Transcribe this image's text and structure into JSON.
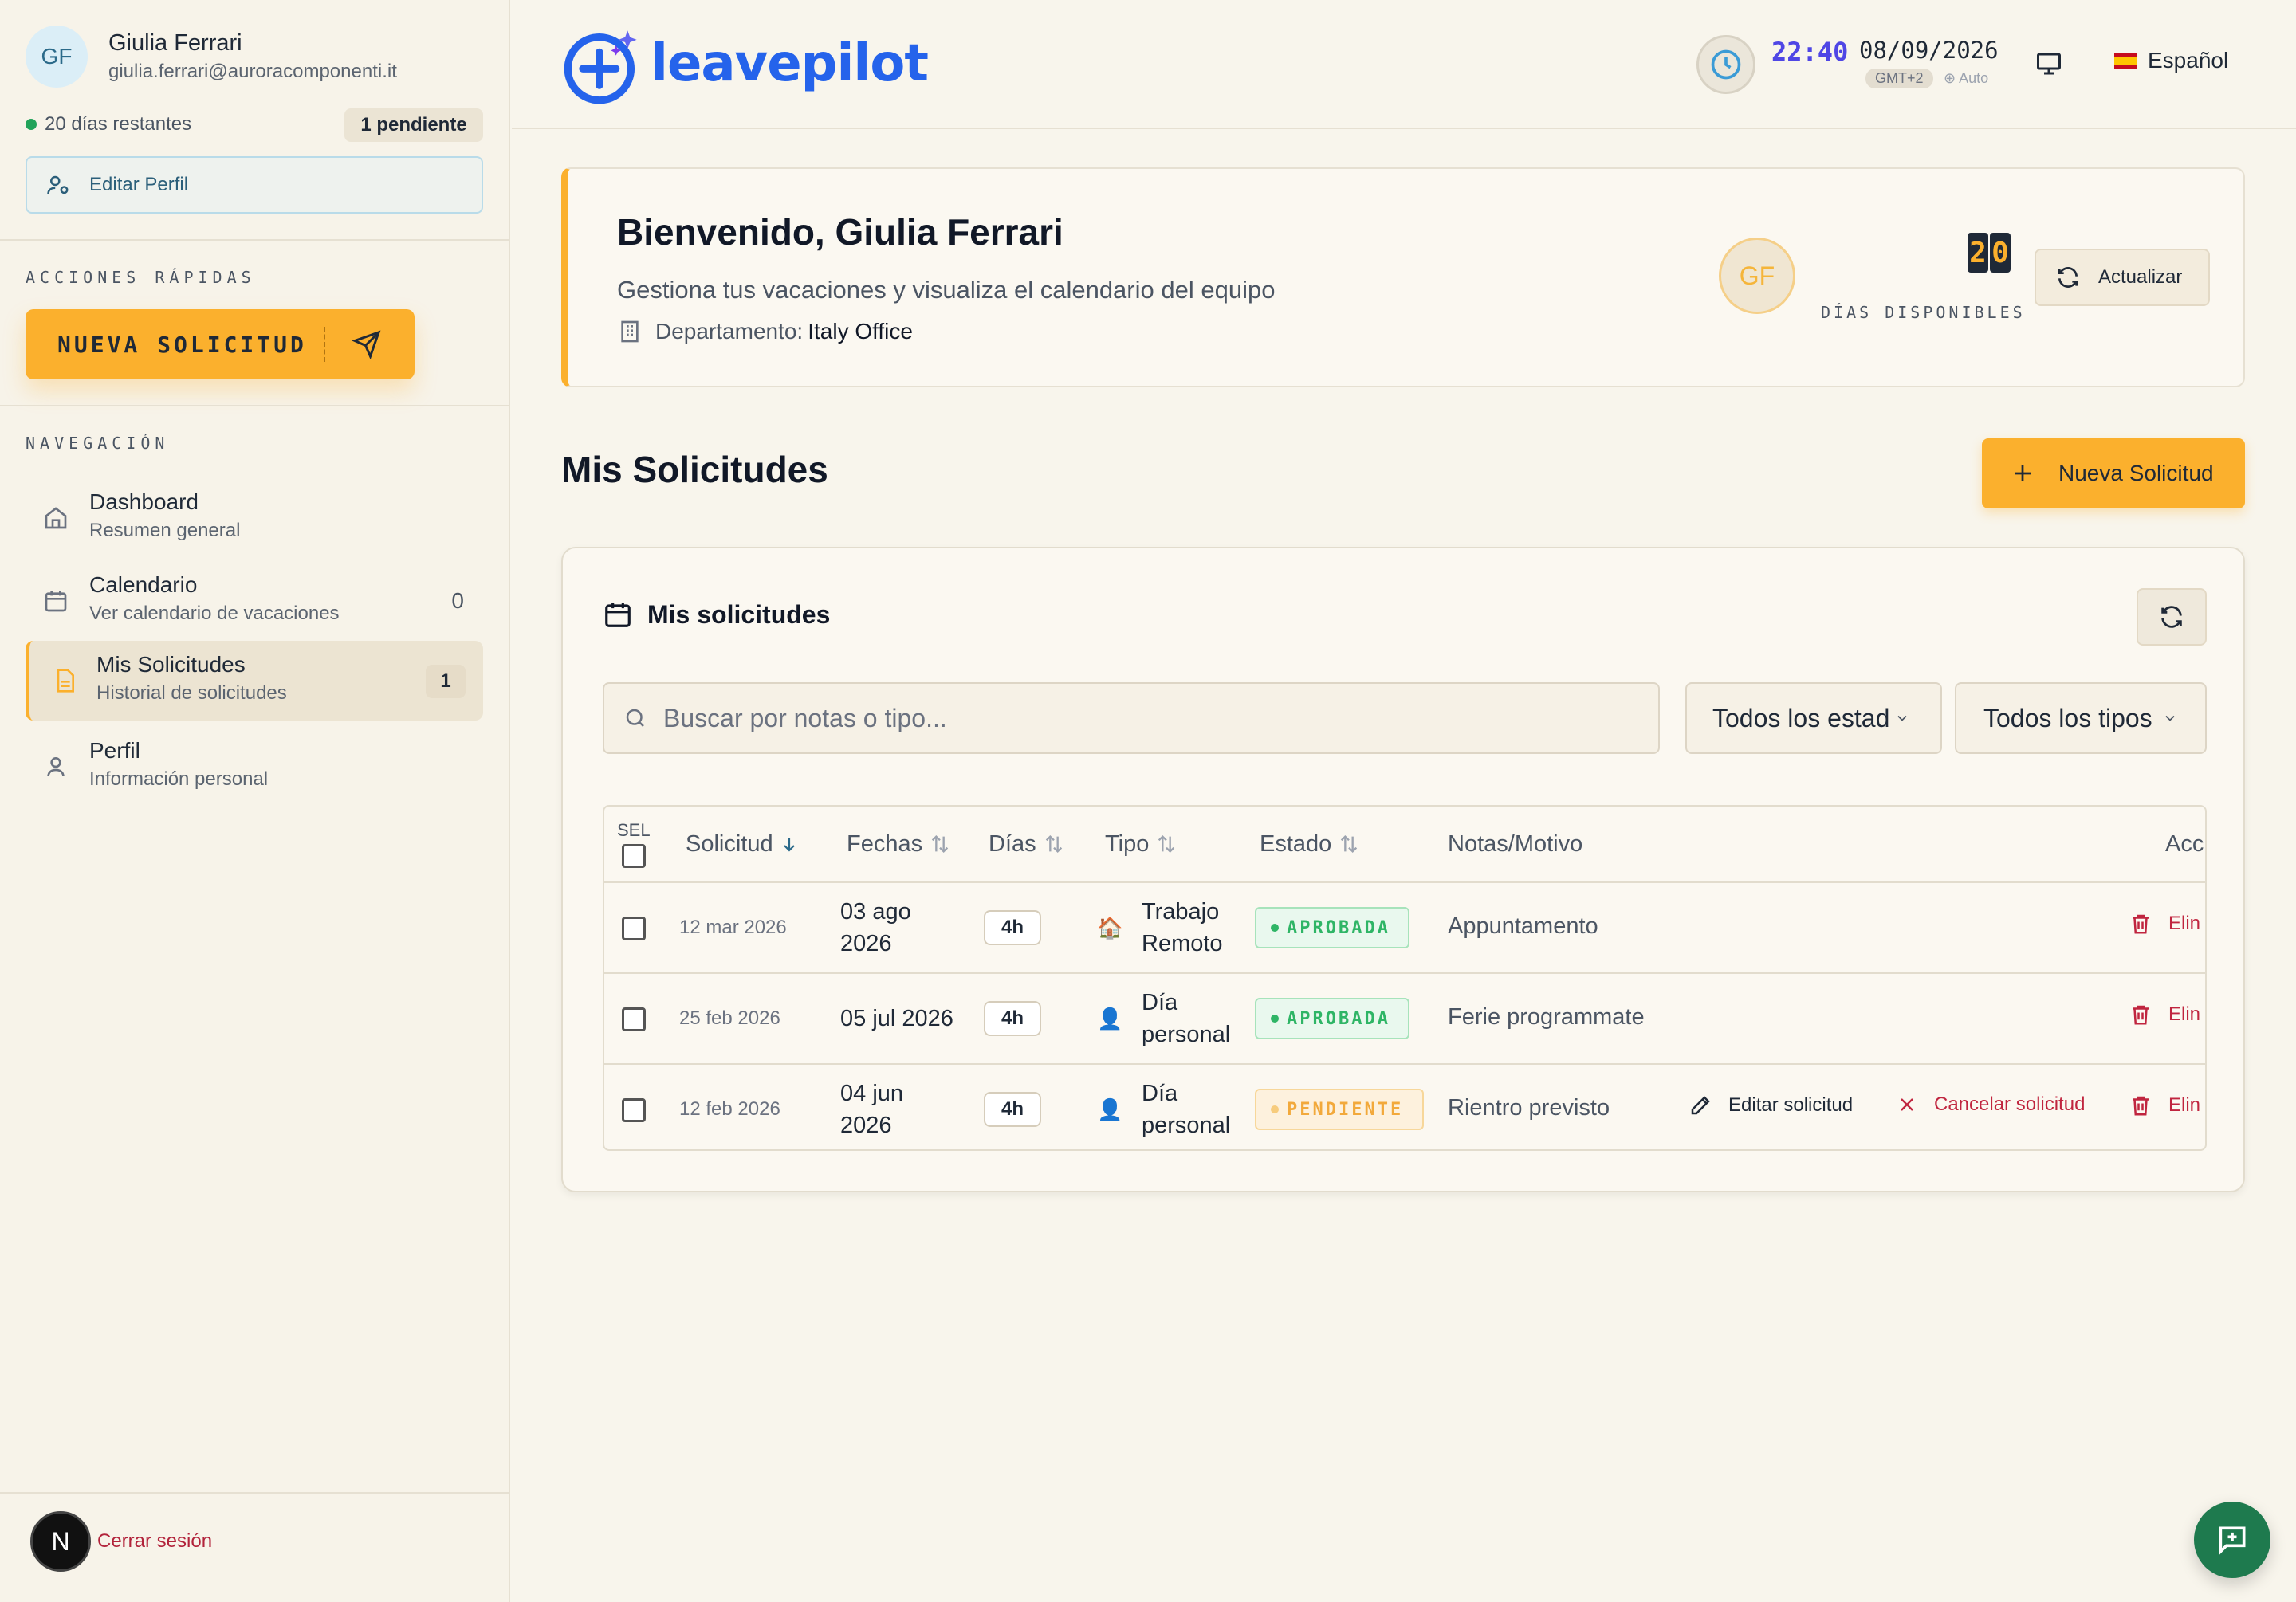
{
  "user": {
    "initials": "GF",
    "name": "Giulia Ferrari",
    "email": "giulia.ferrari@auroracomponenti.it",
    "days_remaining": "20 días restantes",
    "pending": "1 pendiente",
    "edit_profile": "Editar Perfil"
  },
  "sidebar": {
    "quick_actions": "ACCIONES RÁPIDAS",
    "new_request": "NUEVA SOLICITUD",
    "navigation": "NAVEGACIÓN",
    "items": [
      {
        "title": "Dashboard",
        "subtitle": "Resumen general",
        "count": ""
      },
      {
        "title": "Calendario",
        "subtitle": "Ver calendario de vacaciones",
        "count": "0"
      },
      {
        "title": "Mis Solicitudes",
        "subtitle": "Historial de solicitudes",
        "count": "1"
      },
      {
        "title": "Perfil",
        "subtitle": "Información personal",
        "count": ""
      }
    ],
    "logout": "Cerrar sesión",
    "logo_letter": "N"
  },
  "header": {
    "brand": "leavepilot",
    "time": "22:40",
    "date": "08/09/2026",
    "timezone": "GMT+2",
    "tz_mode": "Auto",
    "language": "Español"
  },
  "welcome": {
    "title": "Bienvenido, Giulia Ferrari",
    "subtitle": "Gestiona tus vacaciones y visualiza el calendario del equipo",
    "dept_label": "Departamento:",
    "dept_value": "Italy Office",
    "avatar": "GF",
    "digit1": "2",
    "digit2": "0",
    "days_label": "DÍAS DISPONIBLES",
    "refresh": "Actualizar"
  },
  "section": {
    "title": "Mis Solicitudes",
    "new_button": "Nueva Solicitud"
  },
  "card": {
    "title": "Mis solicitudes",
    "search_placeholder": "Buscar por notas o tipo...",
    "filter_status": "Todos los estad",
    "filter_type": "Todos los tipos",
    "columns": {
      "sel": "SEL",
      "request": "Solicitud",
      "dates": "Fechas",
      "days": "Días",
      "type": "Tipo",
      "status": "Estado",
      "notes": "Notas/Motivo",
      "actions": "Acc"
    },
    "rows": [
      {
        "created": "12 mar 2026",
        "dates_l1": "03 ago",
        "dates_l2": "2026",
        "hours": "4h",
        "type_icon": "🏠",
        "type_l1": "Trabajo",
        "type_l2": "Remoto",
        "status": "APROBADA",
        "status_kind": "ok",
        "notes": "Appuntamento",
        "delete": "Elin"
      },
      {
        "created": "25 feb 2026",
        "dates_l1": "05 jul 2026",
        "dates_l2": "",
        "hours": "4h",
        "type_icon": "👤",
        "type_l1": "Día",
        "type_l2": "personal",
        "status": "APROBADA",
        "status_kind": "ok",
        "notes": "Ferie programmate",
        "delete": "Elin"
      },
      {
        "created": "12 feb 2026",
        "dates_l1": "04 jun",
        "dates_l2": "2026",
        "hours": "4h",
        "type_icon": "👤",
        "type_l1": "Día",
        "type_l2": "personal",
        "status": "PENDIENTE",
        "status_kind": "pend",
        "notes": "Rientro previsto",
        "edit": "Editar solicitud",
        "cancel": "Cancelar solicitud",
        "delete": "Elin"
      }
    ]
  },
  "colors": {
    "accent": "#fbb02d",
    "brand_blue": "#2563eb",
    "approved": "#2fb566",
    "pending": "#f2a93b",
    "danger": "#b2233b"
  }
}
